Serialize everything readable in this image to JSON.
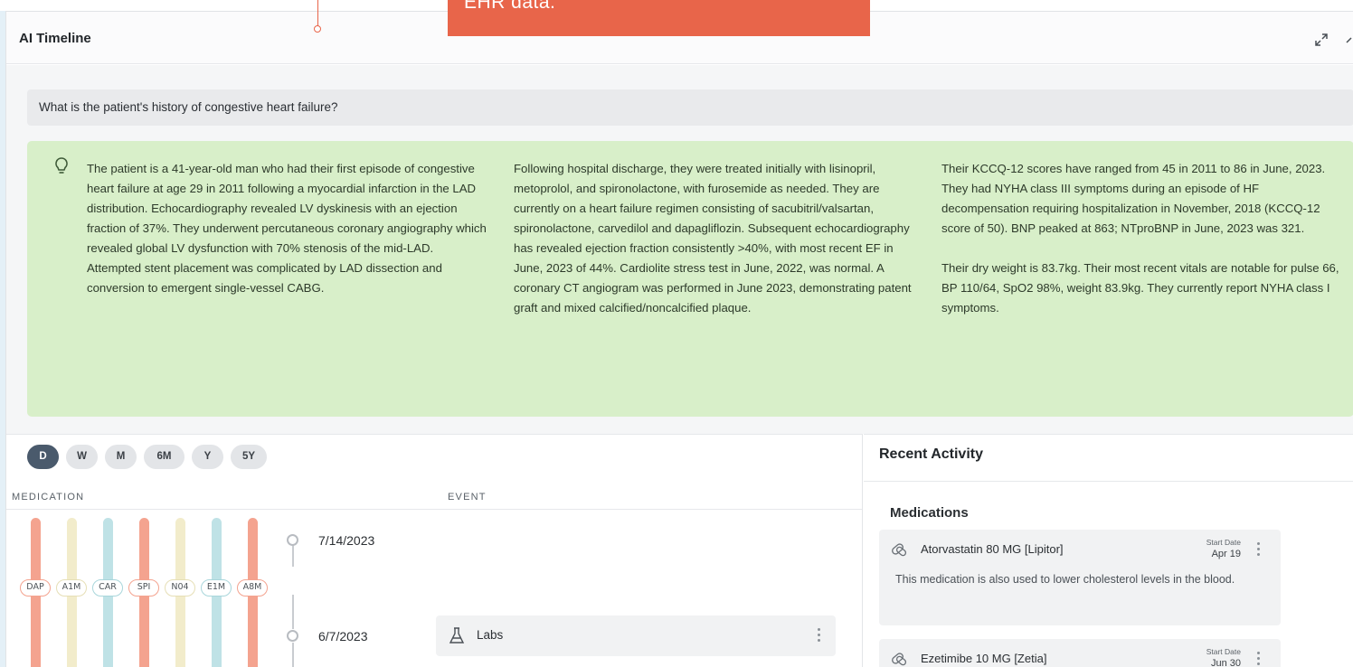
{
  "callout": {
    "text": "EHR data."
  },
  "panel": {
    "title": "AI Timeline"
  },
  "question": "What is the patient's history of congestive heart failure?",
  "answer": {
    "col1": "The patient is a 41-year-old man who had their first episode of congestive heart failure at age 29 in 2011 following a myocardial infarction in the LAD distribution. Echocardiography revealed LV dyskinesis with an ejection fraction of 37%. They underwent percutaneous coronary angiography which revealed global LV dysfunction with 70% stenosis of the mid-LAD. Attempted stent placement was complicated by LAD dissection and conversion to emergent single-vessel CABG.",
    "col2": "Following hospital discharge, they were treated initially with lisinopril, metoprolol, and spironolactone, with furosemide as needed. They are currently on a heart failure regimen consisting of sacubitril/valsartan, spironolactone, carvedilol and dapagliflozin. Subsequent echocardiography has revealed ejection fraction consistently >40%, with most recent EF in June, 2023 of 44%. Cardiolite stress test in June, 2022, was normal. A coronary CT angiogram was performed in June 2023, demonstrating patent graft and mixed calcified/noncalcified plaque.",
    "col3_p1": "Their KCCQ-12 scores have ranged from 45 in 2011 to 86 in June, 2023. They had NYHA class III symptoms during an episode of HF decompensation requiring hospitalization in November, 2018 (KCCQ-12 score of 50). BNP peaked at 863; NTproBNP in June, 2023 was 321.",
    "col3_p2": "Their dry weight is 83.7kg. Their most recent vitals are notable for pulse 66, BP 110/64, SpO2 98%, weight 83.9kg. They currently report NYHA class I symptoms."
  },
  "range_buttons": [
    "D",
    "W",
    "M",
    "6M",
    "Y",
    "5Y"
  ],
  "active_range": "D",
  "columns": {
    "medication": "MEDICATION",
    "event": "EVENT"
  },
  "med_pills": [
    {
      "label": "DAP",
      "color": "#f4a38f"
    },
    {
      "label": "A1M",
      "color": "#f2eccb"
    },
    {
      "label": "CAR",
      "color": "#bfe2e6"
    },
    {
      "label": "SPI",
      "color": "#f4a38f"
    },
    {
      "label": "N04",
      "color": "#f2eccb"
    },
    {
      "label": "E1M",
      "color": "#bfe2e6"
    },
    {
      "label": "A8M",
      "color": "#f4a38f"
    }
  ],
  "timeline": {
    "dates": [
      "7/14/2023",
      "6/7/2023"
    ],
    "event_label": "Labs"
  },
  "recent_activity": {
    "title": "Recent Activity",
    "subtitle": "Medications",
    "start_date_label": "Start Date",
    "meds": [
      {
        "name": "Atorvastatin 80 MG [Lipitor]",
        "start": "Apr 19",
        "desc": "This medication is also used to lower cholesterol levels in the blood."
      },
      {
        "name": "Ezetimibe 10 MG [Zetia]",
        "start": "Jun 30",
        "desc": ""
      }
    ]
  },
  "colors": {
    "accent": "#e8654a",
    "answer_bg": "#d8efc9",
    "active_range": "#4a5a6c"
  }
}
